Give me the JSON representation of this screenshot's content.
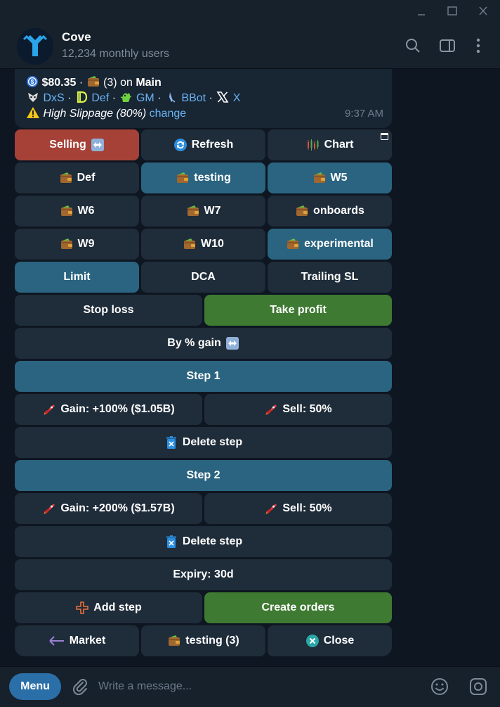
{
  "chat": {
    "title": "Cove",
    "subtitle": "12,234 monthly users"
  },
  "message": {
    "balance": "$80.35",
    "wallet_count": "(3) on",
    "wallet_name": "Main",
    "links": [
      "DxS",
      "Def",
      "GM",
      "BBot",
      "X"
    ],
    "slippage_text": "High Slippage (80%)",
    "change_link": "change",
    "time": "9:37 AM"
  },
  "keyboard": {
    "row1": [
      "Selling",
      "Refresh",
      "Chart"
    ],
    "wallets_row1": [
      "Def",
      "testing",
      "W5"
    ],
    "wallets_row2": [
      "W6",
      "W7",
      "onboards"
    ],
    "wallets_row3": [
      "W9",
      "W10",
      "experimental"
    ],
    "order_types": [
      "Limit",
      "DCA",
      "Trailing SL"
    ],
    "sl_tp": [
      "Stop loss",
      "Take profit"
    ],
    "by_gain": "By % gain",
    "step1": {
      "label": "Step 1",
      "gain": "Gain: +100% ($1.05B)",
      "sell": "Sell: 50%",
      "delete": "Delete step"
    },
    "step2": {
      "label": "Step 2",
      "gain": "Gain: +200% ($1.57B)",
      "sell": "Sell: 50%",
      "delete": "Delete step"
    },
    "expiry": "Expiry: 30d",
    "add_step": "Add step",
    "create_orders": "Create orders",
    "market": "Market",
    "testing_wallet": "testing (3)",
    "close": "Close"
  },
  "composer": {
    "menu_label": "Menu",
    "placeholder": "Write a message..."
  },
  "colors": {
    "accent": "#2b6fa8",
    "selected": "#2a6480",
    "confirm": "#3e7a32",
    "selling": "#a64138",
    "link": "#6ab3f3"
  }
}
